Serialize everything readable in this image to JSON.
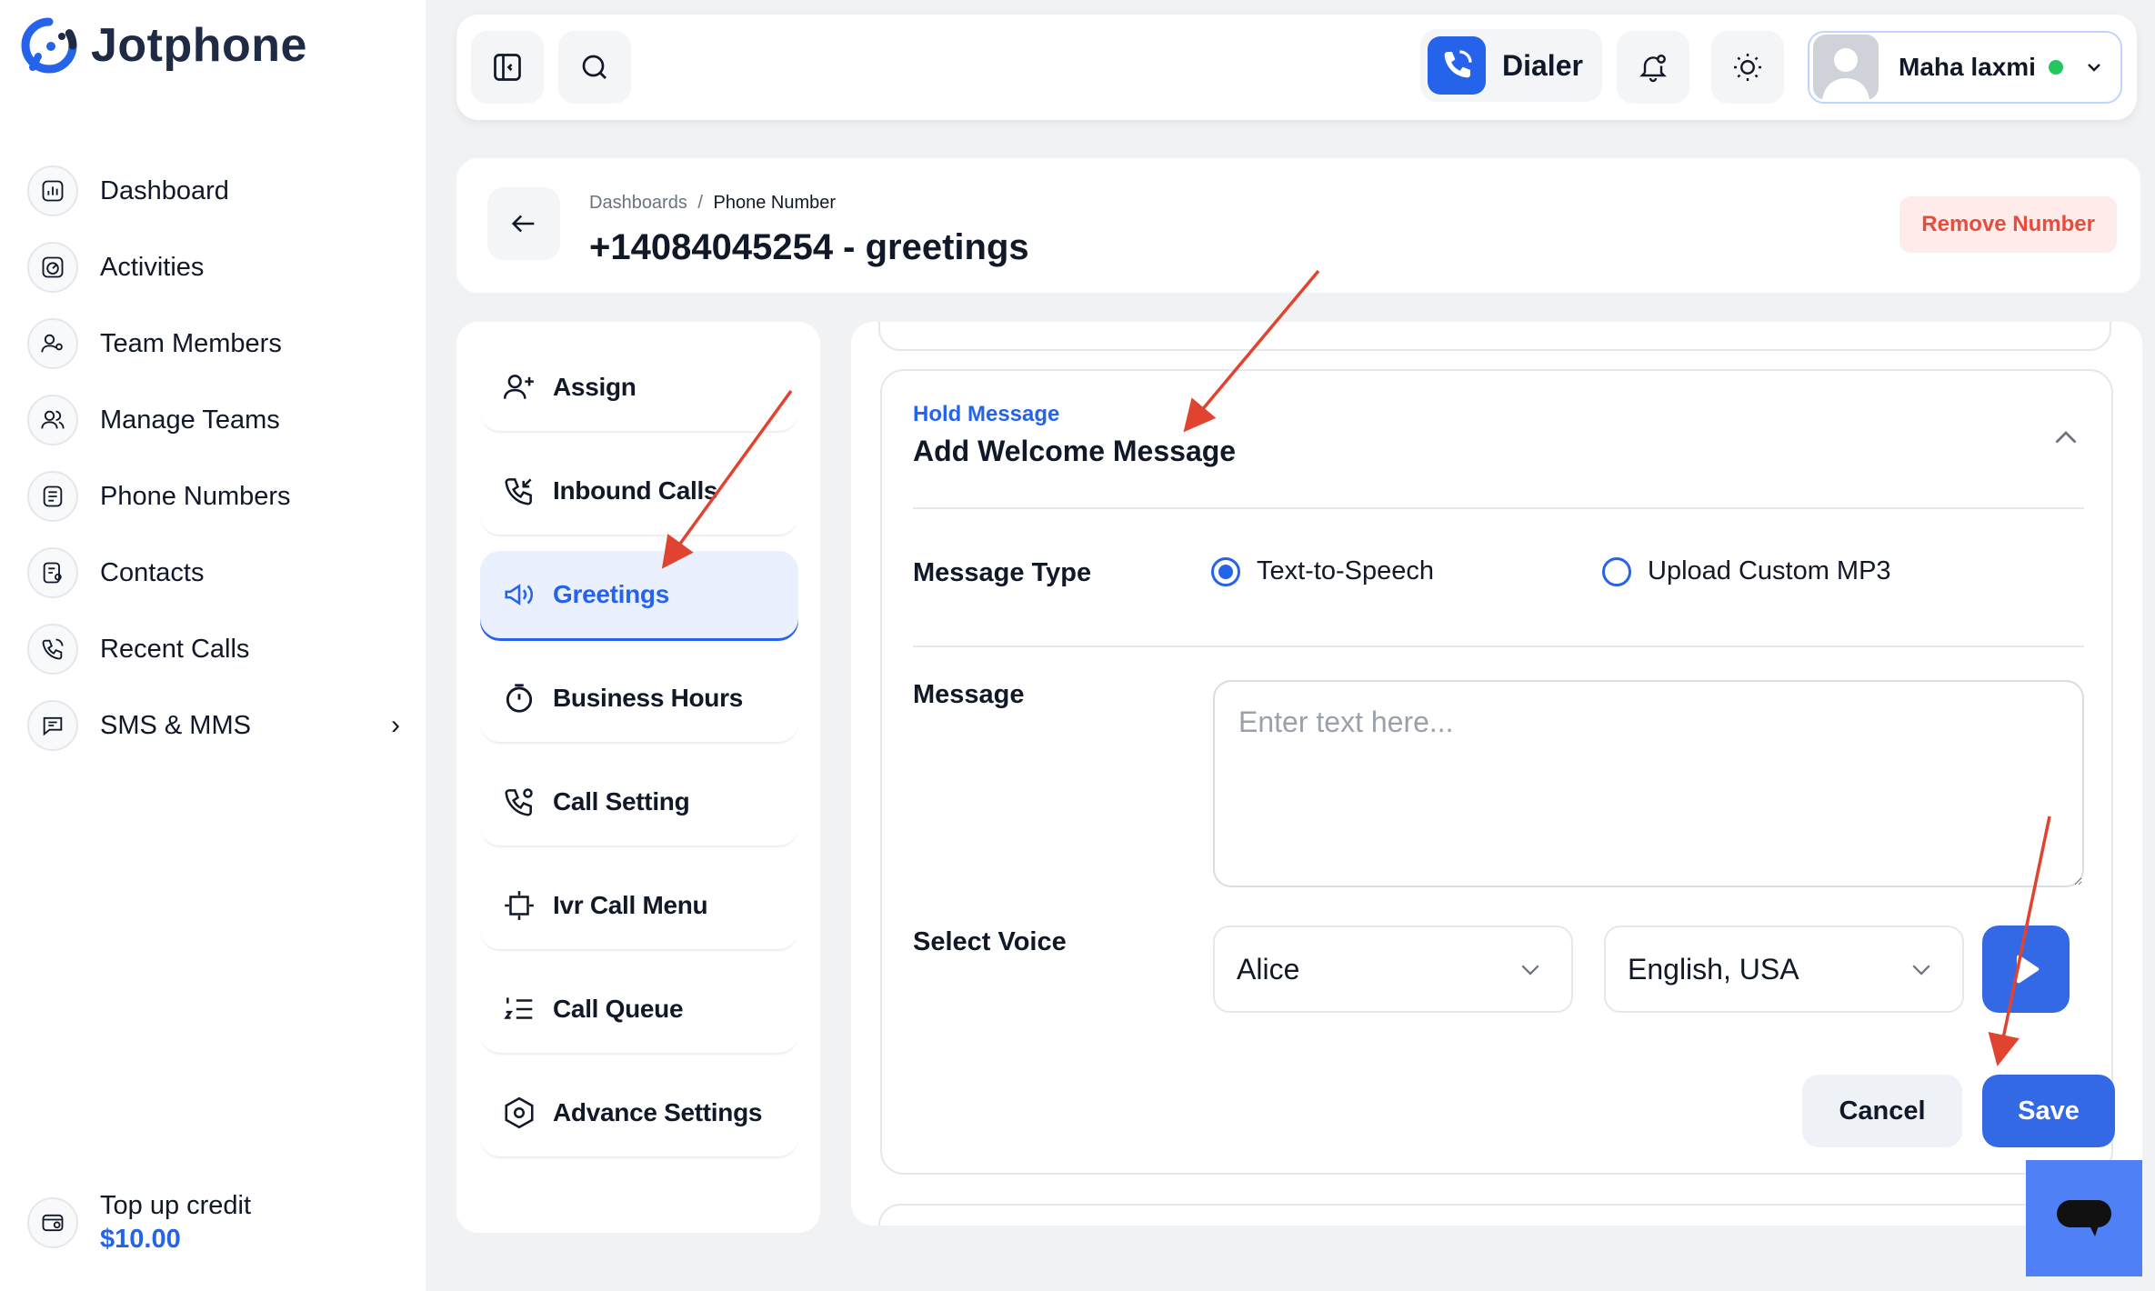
{
  "brand": {
    "name": "Jotphone"
  },
  "sidebar": {
    "items": [
      {
        "label": "Dashboard",
        "icon": "chart-icon"
      },
      {
        "label": "Activities",
        "icon": "gauge-icon"
      },
      {
        "label": "Team Members",
        "icon": "user-gear-icon"
      },
      {
        "label": "Manage Teams",
        "icon": "users-icon"
      },
      {
        "label": "Phone Numbers",
        "icon": "phone-list-icon"
      },
      {
        "label": "Contacts",
        "icon": "contact-card-icon"
      },
      {
        "label": "Recent Calls",
        "icon": "phone-history-icon"
      },
      {
        "label": "SMS & MMS",
        "icon": "message-icon"
      }
    ],
    "sms_chevron": "›",
    "topup": {
      "label": "Top up credit",
      "amount": "$10.00"
    }
  },
  "topbar": {
    "dialer_label": "Dialer",
    "user": {
      "name": "Maha laxmi",
      "status_color": "#22c55e"
    }
  },
  "header": {
    "breadcrumb": {
      "root": "Dashboards",
      "separator": "/",
      "current": "Phone Number"
    },
    "title": "+14084045254 - greetings",
    "remove_label": "Remove Number"
  },
  "menu": {
    "items": [
      {
        "label": "Assign",
        "icon": "user-plus-icon",
        "active": false
      },
      {
        "label": "Inbound Calls",
        "icon": "phone-incoming-icon",
        "active": false
      },
      {
        "label": "Greetings",
        "icon": "megaphone-icon",
        "active": true
      },
      {
        "label": "Business Hours",
        "icon": "timer-icon",
        "active": false
      },
      {
        "label": "Call Setting",
        "icon": "phone-settings-icon",
        "active": false
      },
      {
        "label": "Ivr Call Menu",
        "icon": "frame-icon",
        "active": false
      },
      {
        "label": "Call Queue",
        "icon": "numbered-list-icon",
        "active": false
      },
      {
        "label": "Advance Settings",
        "icon": "hexagon-settings-icon",
        "active": false
      }
    ]
  },
  "section": {
    "subtitle": "Hold Message",
    "title": "Add Welcome Message",
    "message_type_label": "Message Type",
    "options": [
      {
        "label": "Text-to-Speech",
        "selected": true
      },
      {
        "label": "Upload Custom MP3",
        "selected": false
      }
    ],
    "message_label": "Message",
    "message_placeholder": "Enter text here...",
    "message_value": "",
    "voice_label": "Select Voice",
    "voice": "Alice",
    "language": "English, USA",
    "cancel_label": "Cancel",
    "save_label": "Save"
  },
  "colors": {
    "accent": "#2563eb",
    "danger": "#e74c3c",
    "danger_bg": "#fdecea",
    "annotation_arrow": "#e0432f"
  }
}
